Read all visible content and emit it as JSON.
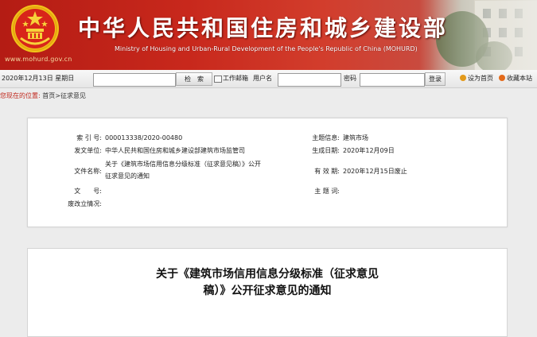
{
  "header": {
    "site_title": "中华人民共和国住房和城乡建设部",
    "site_subtitle": "Ministry of Housing and Urban-Rural Development of the People's Republic of China (MOHURD)",
    "url": "www.mohurd.gov.cn"
  },
  "toolbar": {
    "date": "2020年12月13日",
    "weekday": "星期日",
    "search_button": "检　索",
    "work_portal": "工作邮箱",
    "username_label": "用户名",
    "password_label": "密码",
    "login_button": "登录",
    "set_homepage": "设为首页",
    "bookmark": "收藏本站"
  },
  "breadcrumb": {
    "label": "您现在的位置:",
    "home": "首页",
    "sep": ">",
    "current": "征求意见"
  },
  "info": {
    "index_label": "索 引 号:",
    "index_value": "000013338/2020-00480",
    "issuer_label": "发文单位:",
    "issuer_value": "中华人民共和国住房和城乡建设部建筑市场监管司",
    "docname_label": "文件名称:",
    "docname_line1": "关于《建筑市场信用信息分级标准（征求意见稿）》公开",
    "docname_line2": "征求意见的通知",
    "docno_label": "文　　号:",
    "docno_value": "",
    "abolish_label": "废改立情况:",
    "abolish_value": "",
    "topic_label": "主题信息:",
    "topic_value": "建筑市场",
    "date_label": "生成日期:",
    "date_value": "2020年12月09日",
    "valid_label": "有 效 期:",
    "valid_value": "2020年12月15日废止",
    "keywords_label": "主 题 词:",
    "keywords_value": ""
  },
  "article": {
    "title_line1": "关于《建筑市场信用信息分级标准（征求意见",
    "title_line2": "稿）》公开征求意见的通知"
  },
  "colors": {
    "banner_red": "#c8281c",
    "breadcrumb_red": "#c0261b",
    "emblem_gold": "#f0c419"
  }
}
